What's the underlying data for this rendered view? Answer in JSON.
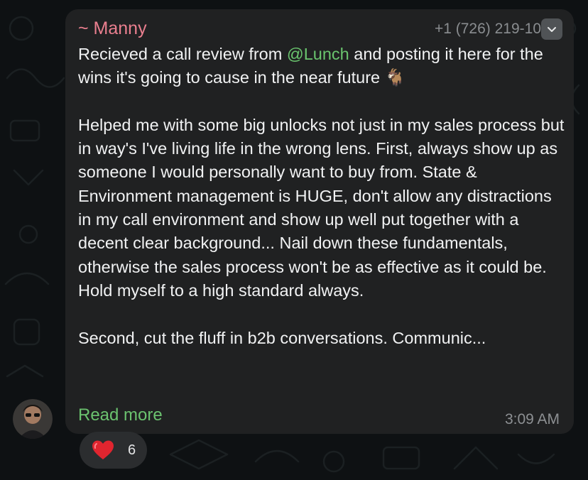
{
  "message": {
    "sender": "~ Manny",
    "phone": "+1 (726) 219-10",
    "paragraph1_before": "Recieved a call review from ",
    "mention": "@Lunch",
    "paragraph1_after": " and posting it here for the wins it's going to cause in the near future 🐐",
    "paragraph2": "Helped me with some big unlocks not just in my sales process but in way's I've living life in the wrong lens. First, always show up as someone I would personally want to buy from. State & Environment management is HUGE, don't allow any distractions in my call environment and show up well put together with a decent clear background... Nail down these fundamentals, otherwise the sales process won't be as effective as it could be. Hold myself to a high standard always.",
    "paragraph3": "Second, cut the fluff in b2b conversations. Communic...",
    "read_more": "Read more",
    "time": "3:09 AM"
  },
  "reaction": {
    "emoji_icon": "heart-icon",
    "count": "6"
  },
  "colors": {
    "background": "#0e1113",
    "bubble": "#202122",
    "sender_name": "#ea7f8f",
    "accent_green": "#6bc26f",
    "heart": "#e0252f"
  }
}
